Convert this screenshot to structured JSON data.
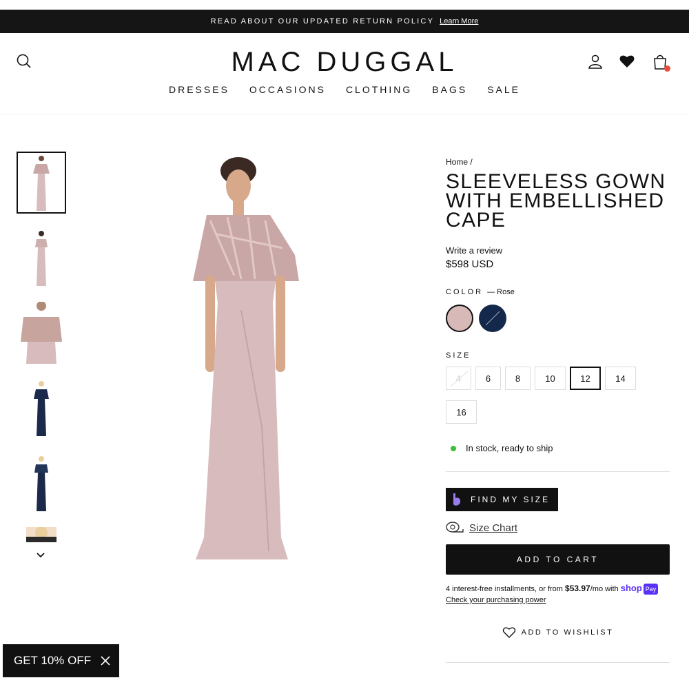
{
  "announcement": {
    "text": "READ ABOUT OUR UPDATED RETURN POLICY",
    "link": "Learn More"
  },
  "header": {
    "logo": "MAC DUGGAL",
    "nav": [
      "DRESSES",
      "OCCASIONS",
      "CLOTHING",
      "BAGS",
      "SALE"
    ],
    "icons": [
      "search-icon",
      "account-icon",
      "heart-icon",
      "cart-icon"
    ]
  },
  "product": {
    "breadcrumb": "Home /",
    "title": "SLEEVELESS GOWN WITH EMBELLISHED CAPE",
    "review": "Write a review",
    "price": "$598 USD",
    "color_label": "COLOR",
    "color_selected": "— Rose",
    "colors": [
      {
        "name": "Rose",
        "hex": "#d7b9b8"
      },
      {
        "name": "Navy",
        "hex": "#13284a"
      }
    ],
    "size_label": "SIZE",
    "sizes": [
      "4",
      "6",
      "8",
      "10",
      "12",
      "14",
      "16"
    ],
    "selected_size": "12",
    "stock": "In stock, ready to ship",
    "find_my_size": "FIND MY SIZE",
    "size_chart": "Size Chart",
    "add_to_cart": "ADD TO CART",
    "installments_pre": "4 interest-free installments, or from ",
    "installments_amount": "$53.97",
    "installments_post": "/mo with ",
    "shop_logo": "shop",
    "pay_badge": "Pay",
    "check_power": "Check your purchasing power",
    "wishlist": "ADD TO WISHLIST"
  },
  "promo": {
    "text": "GET 10% OFF"
  },
  "colors": {
    "dress_rose": "#d8bcbd",
    "navy": "#1b2a4a",
    "accent_shop": "#5a31f4"
  }
}
